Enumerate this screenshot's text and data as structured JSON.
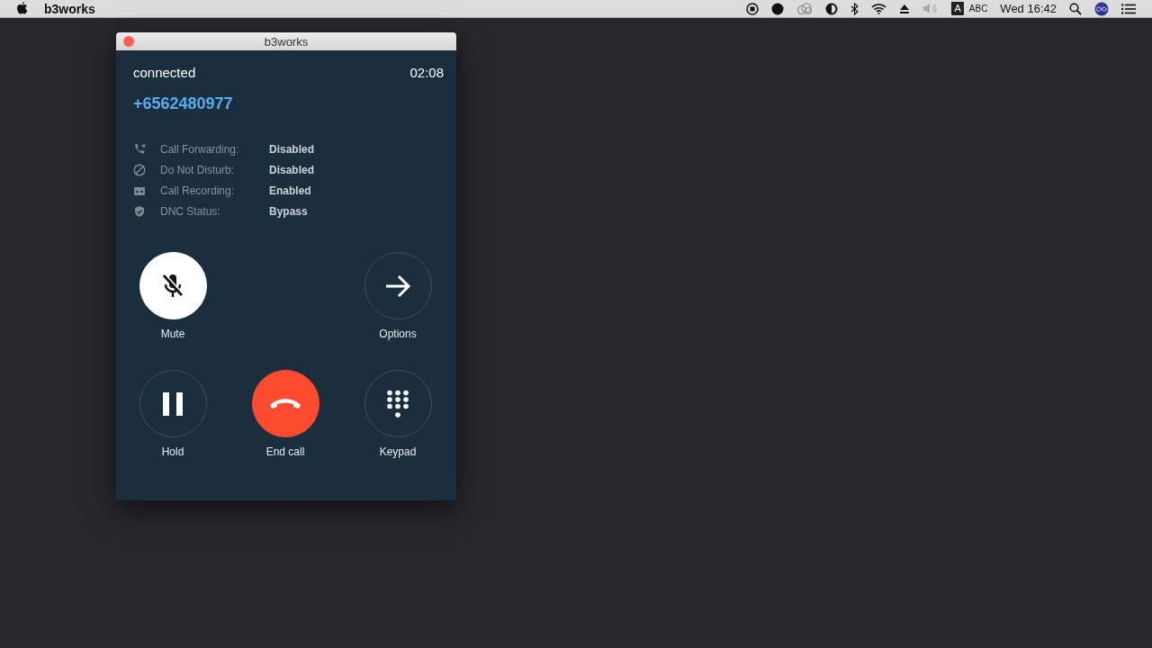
{
  "menubar": {
    "app_name": "b3works",
    "input_letter": "A",
    "input_source": "ABC",
    "clock": "Wed 16:42"
  },
  "window": {
    "title": "b3works"
  },
  "call": {
    "status": "connected",
    "duration": "02:08",
    "number": "+6562480977"
  },
  "info": [
    {
      "kind": "forwarding",
      "label": "Call Forwarding:",
      "value": "Disabled"
    },
    {
      "kind": "dnd",
      "label": "Do Not Disturb:",
      "value": "Disabled"
    },
    {
      "kind": "recording",
      "label": "Call Recording:",
      "value": "Enabled"
    },
    {
      "kind": "dnc",
      "label": "DNC Status:",
      "value": "Bypass"
    }
  ],
  "controls": [
    [
      {
        "kind": "mute",
        "label": "Mute",
        "on": true
      },
      {
        "kind": "options",
        "label": "Options",
        "on": false
      }
    ],
    [
      {
        "kind": "hold",
        "label": "Hold",
        "on": false
      },
      {
        "kind": "end",
        "label": "End call",
        "on": false
      },
      {
        "kind": "keypad",
        "label": "Keypad",
        "on": false
      }
    ]
  ]
}
